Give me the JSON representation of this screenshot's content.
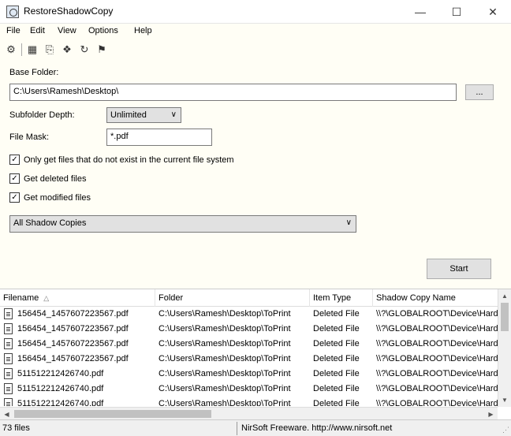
{
  "window": {
    "title": "RestoreShadowCopy",
    "minimize_glyph": "—",
    "maximize_glyph": "☐",
    "close_glyph": "✕"
  },
  "menu": {
    "items": [
      "File",
      "Edit",
      "View",
      "Options",
      "Help"
    ]
  },
  "toolbar": {
    "icons": [
      "properties-icon",
      "save-icon",
      "copy-icon",
      "html-report-icon",
      "refresh-icon",
      "about-icon"
    ],
    "glyphs": [
      "⚙",
      "▦",
      "⎘",
      "❖",
      "↻",
      "⚑"
    ]
  },
  "form": {
    "base_folder_label": "Base Folder:",
    "base_folder_value": "C:\\Users\\Ramesh\\Desktop\\",
    "browse_label": "...",
    "subfolder_depth_label": "Subfolder Depth:",
    "subfolder_depth_value": "Unlimited",
    "file_mask_label": "File Mask:",
    "file_mask_value": "*.pdf",
    "checkbox_1_label": "Only get files that do not exist in the current file system",
    "checkbox_2_label": "Get deleted files",
    "checkbox_3_label": "Get modified files",
    "checked_glyph": "✓",
    "shadow_select_value": "All Shadow Copies",
    "start_label": "Start",
    "arrow_glyph": "∨"
  },
  "list": {
    "columns": [
      "Filename",
      "Folder",
      "Item Type",
      "Shadow Copy Name"
    ],
    "sort_glyph": "△",
    "rows": [
      {
        "filename": "156454_1457607223567.pdf",
        "folder": "C:\\Users\\Ramesh\\Desktop\\ToPrint",
        "type": "Deleted File",
        "shadow": "\\\\?\\GLOBALROOT\\Device\\HarddiskVolumeShadowCopy"
      },
      {
        "filename": "156454_1457607223567.pdf",
        "folder": "C:\\Users\\Ramesh\\Desktop\\ToPrint",
        "type": "Deleted File",
        "shadow": "\\\\?\\GLOBALROOT\\Device\\HarddiskVolumeShadowCopy"
      },
      {
        "filename": "156454_1457607223567.pdf",
        "folder": "C:\\Users\\Ramesh\\Desktop\\ToPrint",
        "type": "Deleted File",
        "shadow": "\\\\?\\GLOBALROOT\\Device\\HarddiskVolumeShadowCopy"
      },
      {
        "filename": "156454_1457607223567.pdf",
        "folder": "C:\\Users\\Ramesh\\Desktop\\ToPrint",
        "type": "Deleted File",
        "shadow": "\\\\?\\GLOBALROOT\\Device\\HarddiskVolumeShadowCopy"
      },
      {
        "filename": "511512212426740.pdf",
        "folder": "C:\\Users\\Ramesh\\Desktop\\ToPrint",
        "type": "Deleted File",
        "shadow": "\\\\?\\GLOBALROOT\\Device\\HarddiskVolumeShadowCopy"
      },
      {
        "filename": "511512212426740.pdf",
        "folder": "C:\\Users\\Ramesh\\Desktop\\ToPrint",
        "type": "Deleted File",
        "shadow": "\\\\?\\GLOBALROOT\\Device\\HarddiskVolumeShadowCopy"
      },
      {
        "filename": "511512212426740.pdf",
        "folder": "C:\\Users\\Ramesh\\Desktop\\ToPrint",
        "type": "Deleted File",
        "shadow": "\\\\?\\GLOBALROOT\\Device\\HarddiskVolumeShadowCopy"
      }
    ],
    "scroll_up": "▲",
    "scroll_down": "▼",
    "scroll_left": "◀",
    "scroll_right": "▶"
  },
  "status": {
    "left": "73 files",
    "right": "NirSoft Freeware. http://www.nirsoft.net",
    "grip": "⋰"
  }
}
